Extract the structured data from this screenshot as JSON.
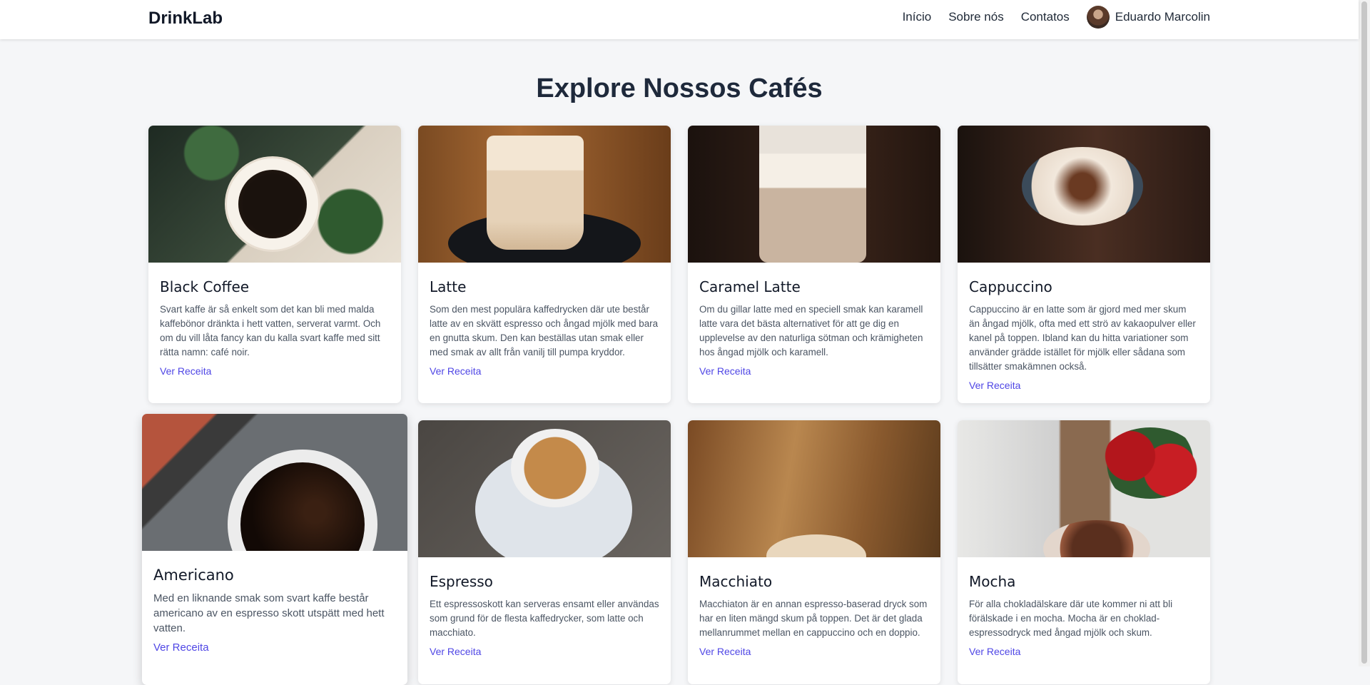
{
  "nav": {
    "brand": "DrinkLab",
    "links": [
      "Início",
      "Sobre nós",
      "Contatos"
    ],
    "user_name": "Eduardo Marcolin"
  },
  "page_title": "Explore Nossos Cafés",
  "cards": [
    {
      "title": "Black Coffee",
      "description": "Svart kaffe är så enkelt som det kan bli med malda kaffebönor dränkta i hett vatten, serverat varmt. Och om du vill låta fancy kan du kalla svart kaffe med sitt rätta namn: café noir.",
      "link": "Ver Receita"
    },
    {
      "title": "Latte",
      "description": "Som den mest populära kaffedrycken där ute består latte av en skvätt espresso och ångad mjölk med bara en gnutta skum. Den kan beställas utan smak eller med smak av allt från vanilj till pumpa kryddor.",
      "link": "Ver Receita"
    },
    {
      "title": "Caramel Latte",
      "description": "Om du gillar latte med en speciell smak kan karamell latte vara det bästa alternativet för att ge dig en upplevelse av den naturliga sötman och krämigheten hos ångad mjölk och karamell.",
      "link": "Ver Receita"
    },
    {
      "title": "Cappuccino",
      "description": "Cappuccino är en latte som är gjord med mer skum än ångad mjölk, ofta med ett strö av kakaopulver eller kanel på toppen. Ibland kan du hitta variationer som använder grädde istället för mjölk eller sådana som tillsätter smakämnen också.",
      "link": "Ver Receita"
    },
    {
      "title": "Americano",
      "description": "Med en liknande smak som svart kaffe består americano av en espresso skott utspätt med hett vatten.",
      "link": "Ver Receita"
    },
    {
      "title": "Espresso",
      "description": "Ett espressoskott kan serveras ensamt eller användas som grund för de flesta kaffedrycker, som latte och macchiato.",
      "link": "Ver Receita"
    },
    {
      "title": "Macchiato",
      "description": "Macchiaton är en annan espresso-baserad dryck som har en liten mängd skum på toppen. Det är det glada mellanrummet mellan en cappuccino och en doppio.",
      "link": "Ver Receita"
    },
    {
      "title": "Mocha",
      "description": "För alla chokladälskare där ute kommer ni att bli förälskade i en mocha. Mocha är en choklad-espressodryck med ångad mjölk och skum.",
      "link": "Ver Receita"
    }
  ]
}
